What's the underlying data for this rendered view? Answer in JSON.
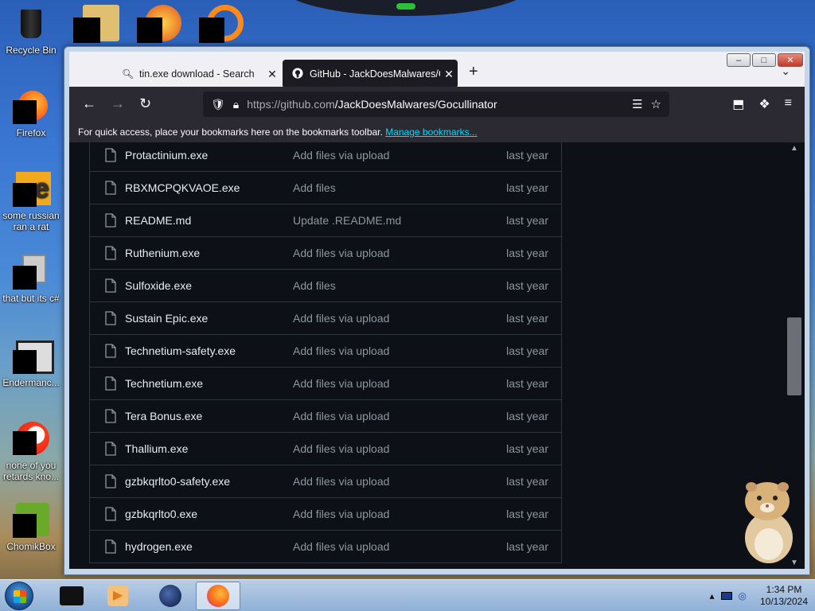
{
  "desktop": {
    "icons": [
      {
        "label": "Recycle Bin",
        "icon": "recycle-bin-icon"
      },
      {
        "label": "Firefox",
        "icon": "firefox-icon"
      },
      {
        "label": "some russian ran a rat",
        "icon": "e-app-icon"
      },
      {
        "label": "that but its c#",
        "icon": "copy-files-icon"
      },
      {
        "label": "Endermanc...",
        "icon": "window-app-icon"
      },
      {
        "label": "none of you retards kno...",
        "icon": "opera-like-icon"
      },
      {
        "label": "ChomikBox",
        "icon": "chomikbox-icon"
      }
    ]
  },
  "browser": {
    "tabs": [
      {
        "label": "tin.exe download - Search",
        "icon": "search-icon"
      },
      {
        "label": "GitHub - JackDoesMalwares/Gocullinator",
        "icon": "github-icon"
      }
    ],
    "url_host": "https://github.com",
    "url_path": "/JackDoesMalwares/Gocullinator",
    "bookmarks_text": "For quick access, place your bookmarks here on the bookmarks toolbar.",
    "bookmarks_link": "Manage bookmarks..."
  },
  "files": [
    {
      "name": "Protactinium.exe",
      "commit": "Add files via upload",
      "when": "last year"
    },
    {
      "name": "RBXMCPQKVAOE.exe",
      "commit": "Add files",
      "when": "last year"
    },
    {
      "name": "README.md",
      "commit": "Update .README.md",
      "when": "last year"
    },
    {
      "name": "Ruthenium.exe",
      "commit": "Add files via upload",
      "when": "last year"
    },
    {
      "name": "Sulfoxide.exe",
      "commit": "Add files",
      "when": "last year"
    },
    {
      "name": "Sustain Epic.exe",
      "commit": "Add files via upload",
      "when": "last year"
    },
    {
      "name": "Technetium-safety.exe",
      "commit": "Add files via upload",
      "when": "last year"
    },
    {
      "name": "Technetium.exe",
      "commit": "Add files via upload",
      "when": "last year"
    },
    {
      "name": "Tera Bonus.exe",
      "commit": "Add files via upload",
      "when": "last year"
    },
    {
      "name": "Thallium.exe",
      "commit": "Add files via upload",
      "when": "last year"
    },
    {
      "name": "gzbkqrlto0-safety.exe",
      "commit": "Add files via upload",
      "when": "last year"
    },
    {
      "name": "gzbkqrlto0.exe",
      "commit": "Add files via upload",
      "when": "last year"
    },
    {
      "name": "hydrogen.exe",
      "commit": "Add files via upload",
      "when": "last year"
    }
  ],
  "taskbar": {
    "items": [
      "black-app-icon",
      "media-player-icon",
      "globe-app-icon",
      "firefox-icon"
    ],
    "time": "1:34 PM",
    "date": "10/13/2024"
  },
  "colors": {
    "page_bg": "#0d1117",
    "border": "#30363d",
    "file_name": "#e6edf3",
    "muted": "#8d96a0",
    "link": "#00ddff"
  }
}
